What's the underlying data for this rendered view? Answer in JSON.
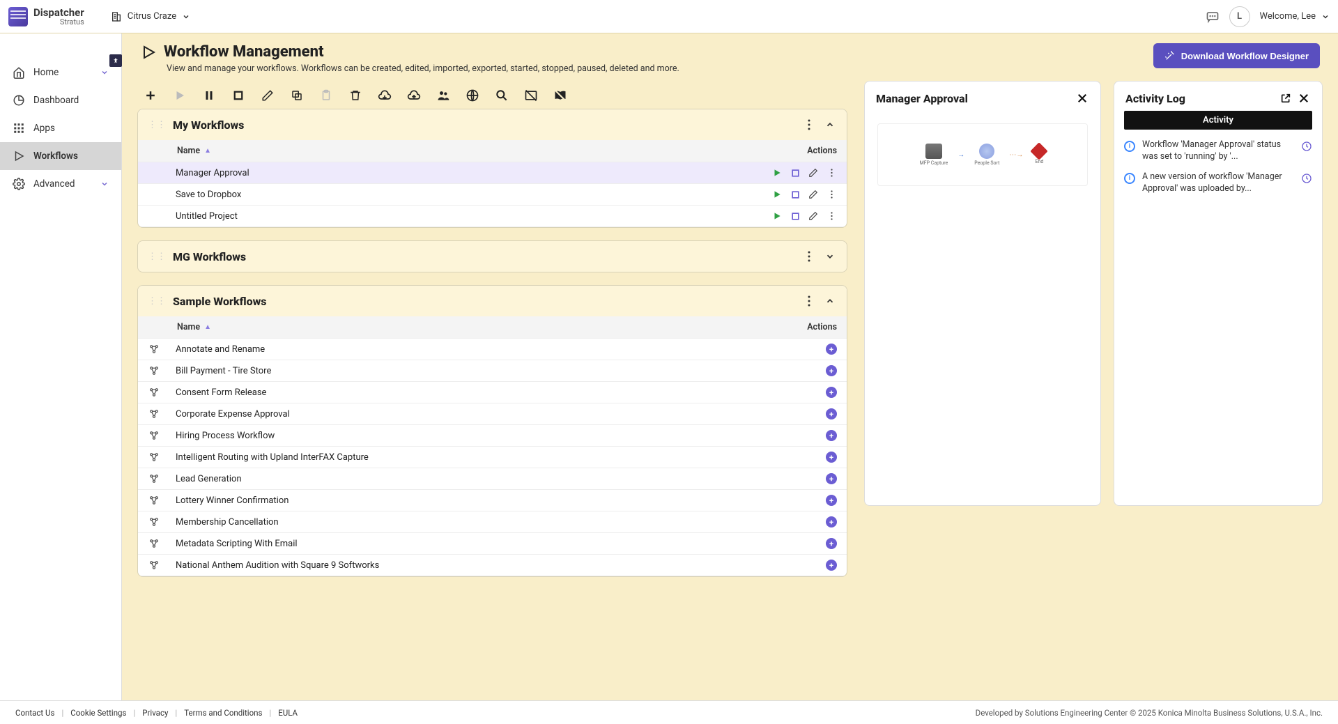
{
  "brand": {
    "line1": "Dispatcher",
    "line2": "Stratus"
  },
  "org_name": "Citrus Craze",
  "user": {
    "initial": "L",
    "welcome": "Welcome, Lee"
  },
  "nav": {
    "home": "Home",
    "dashboard": "Dashboard",
    "apps": "Apps",
    "workflows": "Workflows",
    "advanced": "Advanced"
  },
  "page": {
    "title": "Workflow Management",
    "subtitle": "View and manage your workflows. Workflows can be created, edited, imported, exported, started, stopped, paused, deleted and more.",
    "download_btn": "Download Workflow Designer"
  },
  "table_headers": {
    "name": "Name",
    "actions": "Actions"
  },
  "groups": {
    "my": {
      "title": "My Workflows",
      "rows": [
        {
          "name": "Manager Approval",
          "selected": true
        },
        {
          "name": "Save to Dropbox",
          "selected": false
        },
        {
          "name": "Untitled Project",
          "selected": false
        }
      ]
    },
    "mg": {
      "title": "MG Workflows"
    },
    "sample": {
      "title": "Sample Workflows",
      "rows": [
        {
          "name": "Annotate and Rename"
        },
        {
          "name": "Bill Payment - Tire Store"
        },
        {
          "name": "Consent Form Release"
        },
        {
          "name": "Corporate Expense Approval"
        },
        {
          "name": "Hiring Process Workflow"
        },
        {
          "name": "Intelligent Routing with Upland InterFAX Capture"
        },
        {
          "name": "Lead Generation"
        },
        {
          "name": "Lottery Winner Confirmation"
        },
        {
          "name": "Membership Cancellation"
        },
        {
          "name": "Metadata Scripting With Email"
        },
        {
          "name": "National Anthem Audition with Square 9 Softworks"
        }
      ]
    }
  },
  "preview": {
    "title": "Manager Approval",
    "node1_label": "MFP Capture",
    "node2_label": "People Sort",
    "node3_label": "End"
  },
  "activity": {
    "title": "Activity Log",
    "tab": "Activity",
    "items": [
      "Workflow 'Manager Approval' status was set to 'running' by '...",
      "A new version of workflow 'Manager Approval' was uploaded by..."
    ]
  },
  "footer": {
    "links": [
      "Contact Us",
      "Cookie Settings",
      "Privacy",
      "Terms and Conditions",
      "EULA"
    ],
    "copyright": "Developed by Solutions Engineering Center © 2025 Konica Minolta Business Solutions, U.S.A., Inc."
  }
}
